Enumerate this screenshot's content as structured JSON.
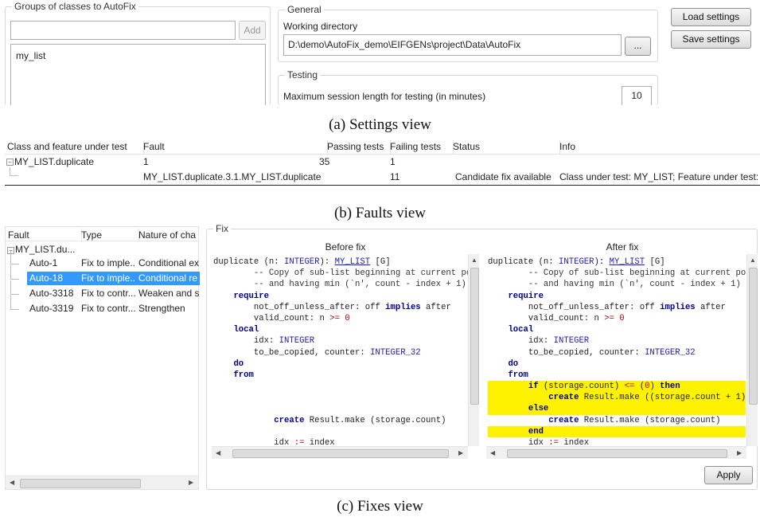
{
  "settings": {
    "groups_legend": "Groups of classes to AutoFix",
    "add_label": "Add",
    "class_list": [
      "my_list"
    ],
    "general_legend": "General",
    "working_dir_label": "Working directory",
    "working_dir_value": "D:\\demo\\AutoFix_demo\\EIFGENs\\project\\Data\\AutoFix",
    "browse_label": "...",
    "testing_legend": "Testing",
    "session_length_label": "Maximum session length for testing (in minutes)",
    "session_length_value": "10",
    "load_label": "Load settings",
    "save_label": "Save settings"
  },
  "captions": {
    "a": "(a) Settings view",
    "b": "(b) Faults view",
    "c": "(c) Fixes view"
  },
  "faults": {
    "headers": [
      "Class and feature under test",
      "Fault",
      "Passing tests",
      "Failing tests",
      "Status",
      "Info"
    ],
    "rows": [
      [
        "MY_LIST.duplicate",
        "1",
        "35",
        "1",
        "",
        ""
      ],
      [
        "",
        "MY_LIST.duplicate.3.1.MY_LIST.duplicate",
        "",
        "11",
        "Candidate fix available",
        "Class under test: MY_LIST; Feature under test:"
      ]
    ]
  },
  "fixes": {
    "headers": [
      "Fault",
      "Type",
      "Nature of cha"
    ],
    "root": "MY_LIST.du...",
    "rows": [
      [
        "Auto-1",
        "Fix to imple...",
        "Conditional ex"
      ],
      [
        "Auto-18",
        "Fix to imple...",
        "Conditional re"
      ],
      [
        "Auto-3318",
        "Fix to contr...",
        "Weaken and s"
      ],
      [
        "Auto-3319",
        "Fix to contr...",
        "Strengthen"
      ]
    ],
    "selected_index": 1,
    "fix_legend": "Fix",
    "before_title": "Before fix",
    "after_title": "After fix",
    "apply_label": "Apply",
    "before_code": [
      "duplicate (n: INTEGER): MY_LIST [G]",
      "        -- Copy of sub-list beginning at current posit",
      "        -- and having min (`n', count - index + 1) ite",
      "    require",
      "        not_off_unless_after: off implies after",
      "        valid_count: n >= 0",
      "    local",
      "        idx: INTEGER",
      "        to_be_copied, counter: INTEGER_32",
      "    do",
      "    from",
      "",
      "",
      "",
      "            create Result.make (storage.count)",
      "",
      "            idx := index"
    ],
    "after_code": [
      "duplicate (n: INTEGER): MY_LIST [G]",
      "        -- Copy of sub-list beginning at current posit",
      "        -- and having min (`n', count - index + 1) ite",
      "    require",
      "        not_off_unless_after: off implies after",
      "        valid_count: n >= 0",
      "    local",
      "        idx: INTEGER",
      "        to_be_copied, counter: INTEGER_32",
      "    do",
      "    from",
      "        if (storage.count) <= (0) then",
      "            create Result.make ((storage.count + 1))",
      "        else",
      "            create Result.make (storage.count)",
      "        end",
      "        idx := index"
    ],
    "after_highlight_lines": [
      11,
      12,
      13,
      15
    ],
    "keywords": [
      "require",
      "local",
      "do",
      "from",
      "if",
      "then",
      "else",
      "end",
      "create",
      "implies"
    ],
    "types": [
      "INTEGER_32",
      "INTEGER",
      "MY_LIST"
    ]
  }
}
